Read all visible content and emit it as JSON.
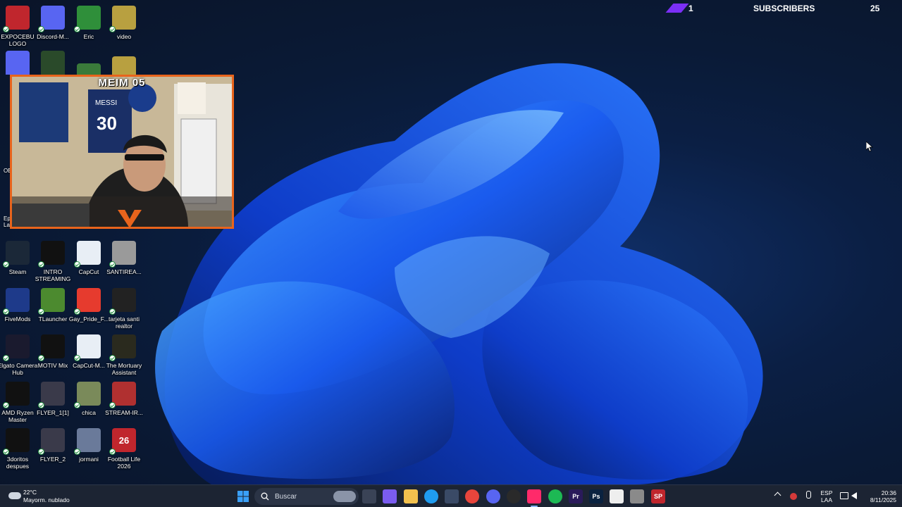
{
  "desktop": {
    "icons": [
      {
        "label": "EXPOCEBU LOGO",
        "icon": "expocebu-logo-icon",
        "color": "#c0262d"
      },
      {
        "label": "Discord-M...",
        "icon": "discord-icon",
        "color": "#5865f2"
      },
      {
        "label": "Eric",
        "icon": "eric-icon",
        "color": "#2f8f3a"
      },
      {
        "label": "video",
        "icon": "video-file-icon",
        "color": "#b8a040"
      },
      {
        "label": "Steam",
        "icon": "steam-icon",
        "color": "#1b2838"
      },
      {
        "label": "INTRO STREAMING",
        "icon": "intro-streaming-icon",
        "color": "#111111"
      },
      {
        "label": "CapCut",
        "icon": "capcut-icon",
        "color": "#e8eef5"
      },
      {
        "label": "SANTIREA...",
        "icon": "santirea-file-icon",
        "color": "#9a9a9a"
      },
      {
        "label": "FiveMods",
        "icon": "fivemods-icon",
        "color": "#1e3a8a"
      },
      {
        "label": "TLauncher",
        "icon": "tlauncher-icon",
        "color": "#4c8a2f"
      },
      {
        "label": "Gay_Pride_F...",
        "icon": "pride-flag-icon",
        "color": "#e63b2e"
      },
      {
        "label": "tarjeta santi realtor",
        "icon": "tarjeta-file-icon",
        "color": "#222222"
      },
      {
        "label": "Elgato Camera Hub",
        "icon": "elgato-icon",
        "color": "#1a1a2e"
      },
      {
        "label": "MOTIV Mix",
        "icon": "motiv-mix-icon",
        "color": "#111111"
      },
      {
        "label": "CapCut-M...",
        "icon": "capcut-m-icon",
        "color": "#e8eef5"
      },
      {
        "label": "The Mortuary Assistant",
        "icon": "mortuary-assistant-icon",
        "color": "#2a2a1e"
      },
      {
        "label": "AMD Ryzen Master",
        "icon": "amd-ryzen-icon",
        "color": "#111111"
      },
      {
        "label": "FLYER_1[1]",
        "icon": "flyer-file-icon",
        "color": "#3a3a4a"
      },
      {
        "label": "chica",
        "icon": "chica-image-icon",
        "color": "#7a8a5a"
      },
      {
        "label": "STREAM-IR...",
        "icon": "stream-ir-icon",
        "color": "#b03030"
      },
      {
        "label": "3doritos despues",
        "icon": "doritos-icon",
        "color": "#111111"
      },
      {
        "label": "FLYER_2",
        "icon": "flyer2-file-icon",
        "color": "#3a3a4a"
      },
      {
        "label": "jormani",
        "icon": "jormani-image-icon",
        "color": "#6a7a9a"
      },
      {
        "label": "Football Life 2026",
        "icon": "football-life-icon",
        "color": "#c0262d",
        "text": "26"
      }
    ],
    "partial_labels": {
      "obs": "OB",
      "epic": "Epi La"
    }
  },
  "webcam": {
    "title": "MEIM 05",
    "jersey_name": "MESSI",
    "jersey_number": "30"
  },
  "overlay": {
    "left_count": "1",
    "label": "SUBSCRIBERS",
    "right_count": "25",
    "accent": "#7b2ff7"
  },
  "taskbar": {
    "weather": {
      "temp": "22°C",
      "desc": "Mayorm. nublado"
    },
    "search_placeholder": "Buscar",
    "apps": [
      {
        "icon": "task-view-icon",
        "color": "#3a4356"
      },
      {
        "icon": "copilot-icon",
        "color": "#7a5cf0"
      },
      {
        "icon": "file-explorer-icon",
        "color": "#f2c14e"
      },
      {
        "icon": "edge-icon",
        "color": "#1f9cf0"
      },
      {
        "icon": "microsoft-store-icon",
        "color": "#3a4a66"
      },
      {
        "icon": "chrome-icon",
        "color": "#e8453c"
      },
      {
        "icon": "discord-taskbar-icon",
        "color": "#5865f2"
      },
      {
        "icon": "obs-icon",
        "color": "#2a2a2a"
      },
      {
        "icon": "tiktok-live-icon",
        "color": "#ff2a6a"
      },
      {
        "icon": "spotify-icon",
        "color": "#1db954"
      },
      {
        "icon": "premiere-icon",
        "color": "#2a1a5a",
        "text": "Pr"
      },
      {
        "icon": "photoshop-icon",
        "color": "#0a2240",
        "text": "Ps"
      },
      {
        "icon": "capcut-taskbar-icon",
        "color": "#eeeeee"
      },
      {
        "icon": "tools-icon",
        "color": "#8a8a8a"
      },
      {
        "icon": "sp-app-icon",
        "color": "#c0262d",
        "text": "SP"
      }
    ],
    "tray": {
      "lang1": "ESP",
      "lang2": "LAA",
      "time": "20:36",
      "date": "8/11/2025"
    }
  }
}
